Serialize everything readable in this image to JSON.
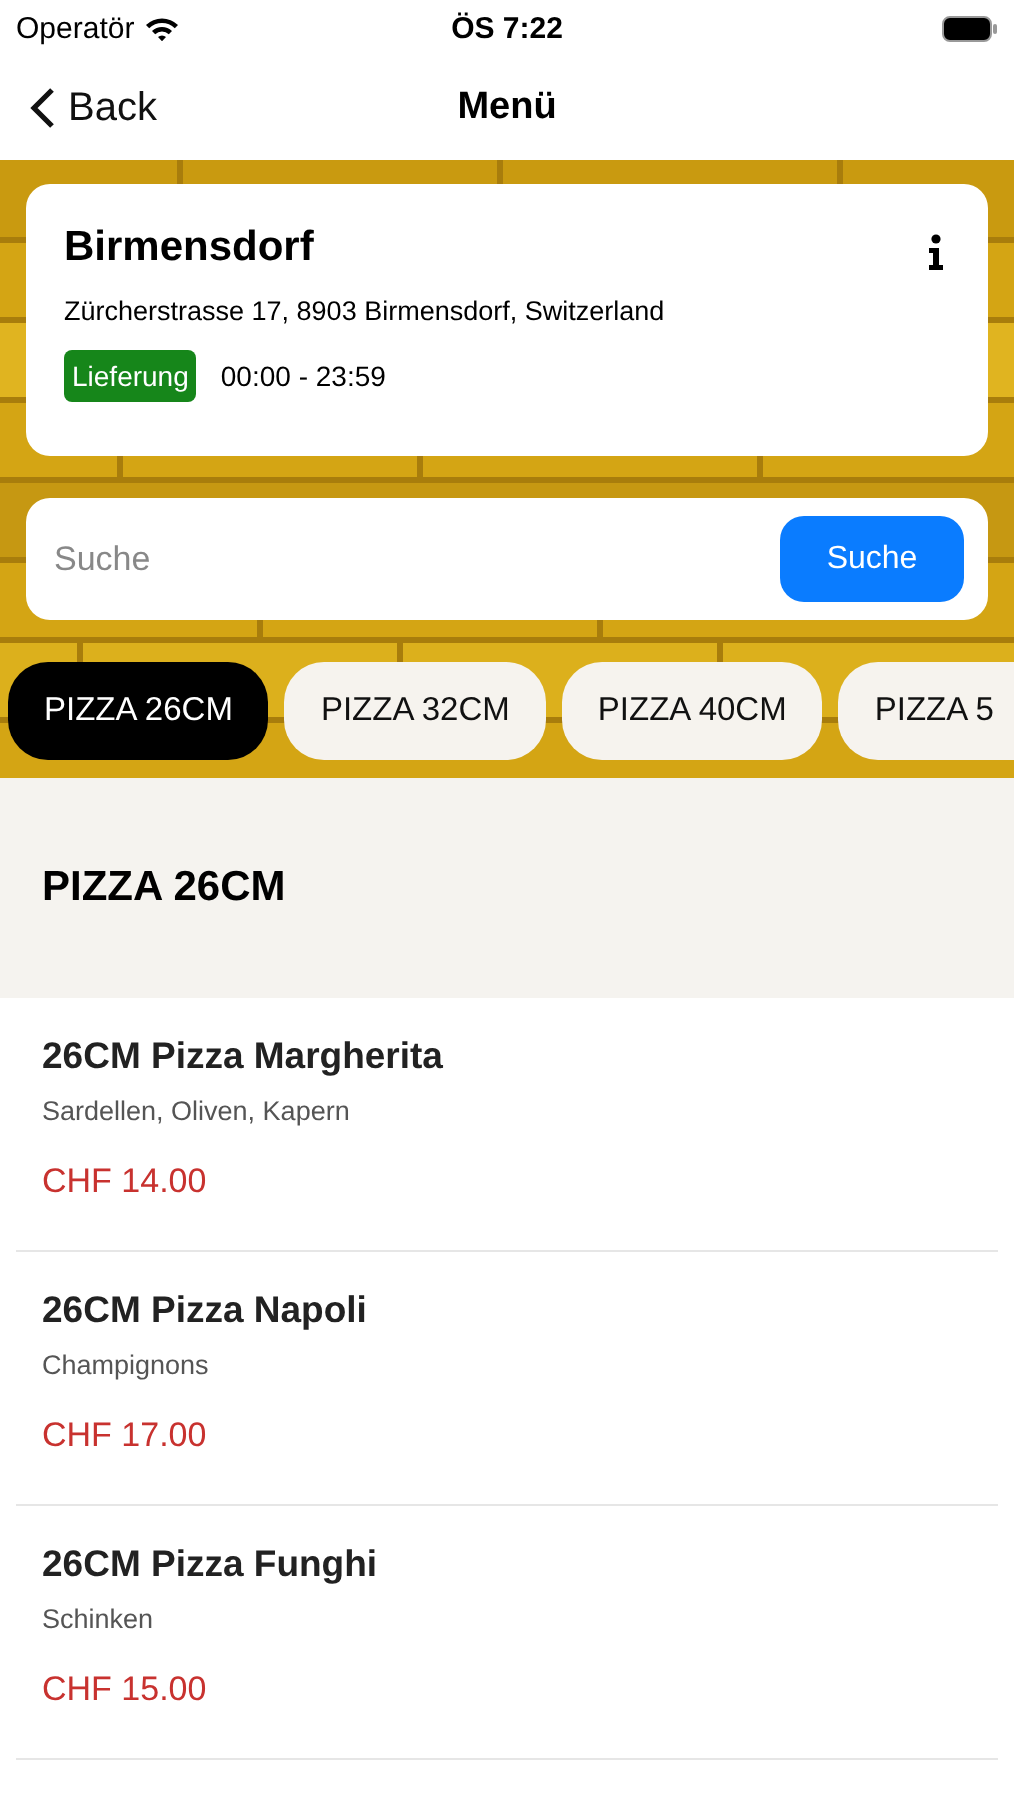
{
  "status_bar": {
    "carrier": "Operatör",
    "time": "ÖS 7:22"
  },
  "nav": {
    "back": "Back",
    "title": "Menü"
  },
  "store": {
    "name": "Birmensdorf",
    "address": "Zürcherstrasse 17, 8903 Birmensdorf, Switzerland",
    "badge": "Lieferung",
    "hours": "00:00 - 23:59"
  },
  "search": {
    "placeholder": "Suche",
    "button": "Suche"
  },
  "tabs": [
    {
      "label": "PIZZA 26CM",
      "selected": true
    },
    {
      "label": "PIZZA 32CM",
      "selected": false
    },
    {
      "label": "PIZZA 40CM",
      "selected": false
    },
    {
      "label": "PIZZA 5",
      "selected": false
    }
  ],
  "section": {
    "title": "PIZZA 26CM"
  },
  "items": [
    {
      "name": "26CM Pizza Margherita",
      "description": "Sardellen, Oliven, Kapern",
      "price": "CHF 14.00"
    },
    {
      "name": "26CM Pizza Napoli",
      "description": "Champignons",
      "price": "CHF 17.00"
    },
    {
      "name": "26CM Pizza Funghi",
      "description": "Schinken",
      "price": "CHF 15.00"
    }
  ]
}
